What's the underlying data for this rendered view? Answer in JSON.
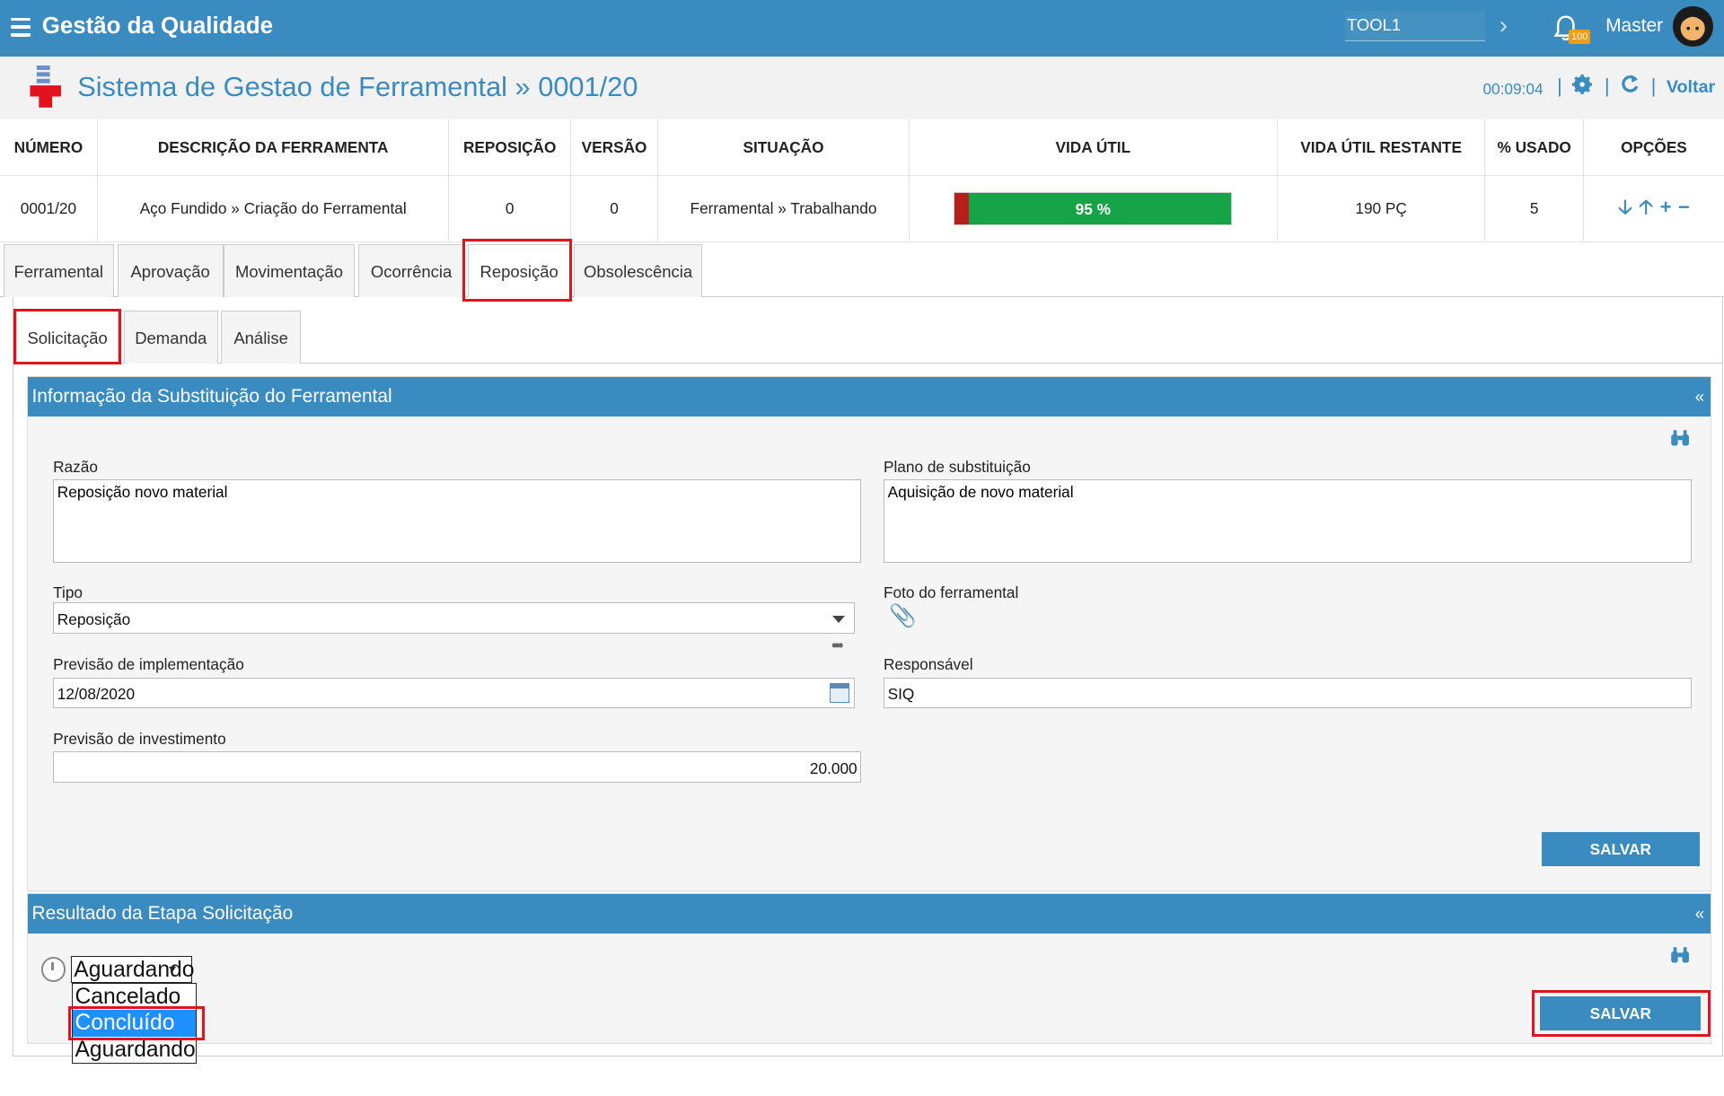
{
  "app": {
    "title": "Gestão da Qualidade",
    "tool_value": "TOOL1",
    "badge_count": "100",
    "user": "Master"
  },
  "header": {
    "title": "Sistema de Gestao de Ferramental » 0001/20",
    "timer": "00:09:04",
    "back_label": "Voltar"
  },
  "table": {
    "columns": [
      "NÚMERO",
      "DESCRIÇÃO DA FERRAMENTA",
      "REPOSIÇÃO",
      "VERSÃO",
      "SITUAÇÃO",
      "VIDA ÚTIL",
      "VIDA ÚTIL RESTANTE",
      "% USADO",
      "OPÇÕES"
    ],
    "row": {
      "numero": "0001/20",
      "descricao": "Aço Fundido » Criação do Ferramental",
      "reposicao": "0",
      "versao": "0",
      "situacao": "Ferramental » Trabalhando",
      "vida_util_label": "95 %",
      "vida_util_percent": 95,
      "vida_restante": "190 PÇ",
      "usado": "5"
    },
    "colors": {
      "bar_green": "#17a347",
      "bar_red": "#b81d1d"
    }
  },
  "tabs": [
    "Ferramental",
    "Aprovação",
    "Movimentação",
    "Ocorrência",
    "Reposição",
    "Obsolescência"
  ],
  "active_tab": "Reposição",
  "subtabs": [
    "Solicitação",
    "Demanda",
    "Análise"
  ],
  "active_subtab": "Solicitação",
  "section1": {
    "title": "Informação da Substituição do Ferramental",
    "collapse": "«",
    "razao_label": "Razão",
    "razao_value": "Reposição novo material",
    "plano_label": "Plano de substituição",
    "plano_value": "Aquisição de novo material",
    "tipo_label": "Tipo",
    "tipo_value": "Reposição",
    "foto_label": "Foto do ferramental",
    "previsao_impl_label": "Previsão de implementação",
    "previsao_impl_value": "12/08/2020",
    "responsavel_label": "Responsável",
    "responsavel_value": "SIQ",
    "previsao_inv_label": "Previsão de investimento",
    "previsao_inv_value": "20.000",
    "save_label": "SALVAR"
  },
  "section2": {
    "title": "Resultado da Etapa Solicitação",
    "collapse": "«",
    "status_value": "Aguardando",
    "options": [
      "Cancelado",
      "Concluído",
      "Aguardando"
    ],
    "highlighted_option": "Concluído",
    "save_label": "SALVAR"
  },
  "accent_color": "#3a8bbf",
  "highlight_color": "#e1131e"
}
